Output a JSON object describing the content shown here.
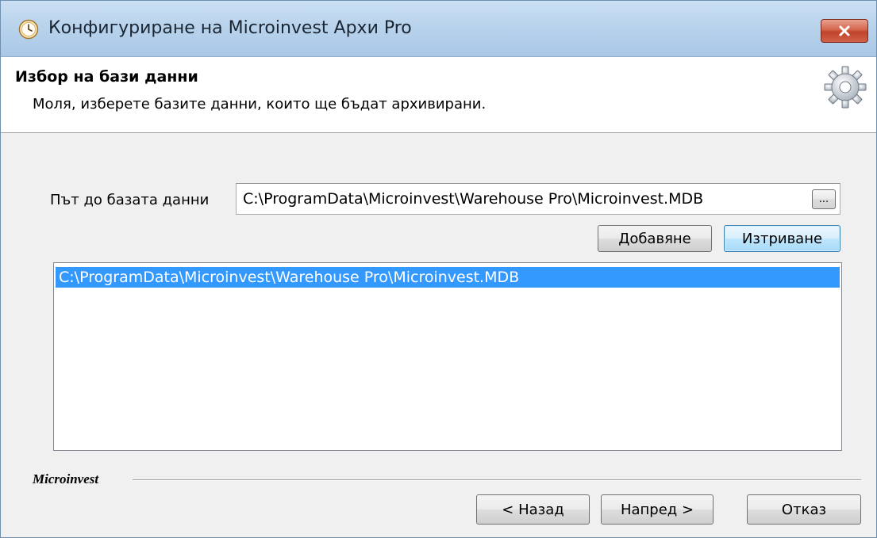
{
  "window": {
    "title": "Конфигуриране на Microinvest Архи Pro",
    "app_icon": "clock-icon",
    "close_icon": "close-icon"
  },
  "header": {
    "title": "Избор на бази данни",
    "subtitle": "Моля, изберете базите данни, които ще бъдат архивирани.",
    "icon": "gear-icon"
  },
  "form": {
    "path_label": "Път до базата данни",
    "path_value": "C:\\ProgramData\\Microinvest\\Warehouse Pro\\Microinvest.MDB",
    "browse_label": "...",
    "add_label": "Добавяне",
    "delete_label": "Изтриване"
  },
  "database_list": {
    "items": [
      {
        "path": "C:\\ProgramData\\Microinvest\\Warehouse Pro\\Microinvest.MDB",
        "selected": true
      }
    ]
  },
  "footer": {
    "brand": "Microinvest",
    "back_label": "< Назад",
    "next_label": "Напред >",
    "cancel_label": "Отказ"
  },
  "colors": {
    "selection": "#3399ff",
    "titlebar": "#b9d3ec",
    "close_button": "#c0432a",
    "window_background": "#f0f0f0"
  }
}
